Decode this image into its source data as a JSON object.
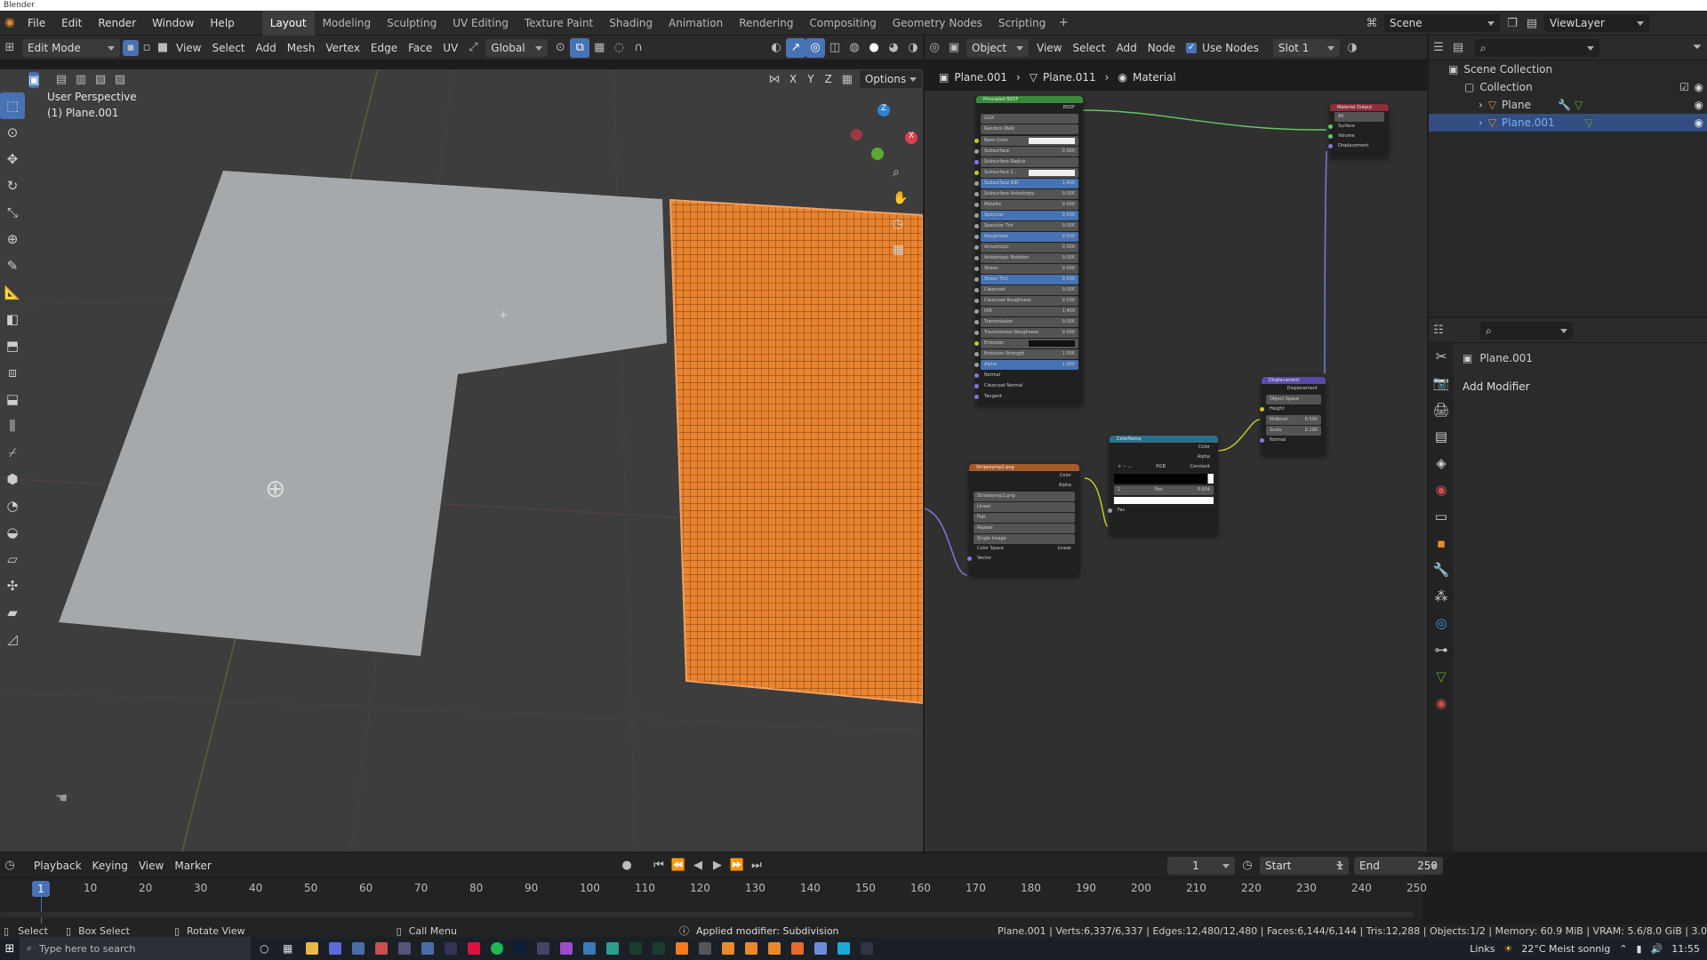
{
  "app": {
    "title": "Blender"
  },
  "menu": [
    "File",
    "Edit",
    "Render",
    "Window",
    "Help"
  ],
  "workspaces": [
    "Layout",
    "Modeling",
    "Sculpting",
    "UV Editing",
    "Texture Paint",
    "Shading",
    "Animation",
    "Rendering",
    "Compositing",
    "Geometry Nodes",
    "Scripting"
  ],
  "active_workspace": "Layout",
  "scene": "Scene",
  "view_layer": "ViewLayer",
  "viewport": {
    "mode": "Edit Mode",
    "menus": [
      "View",
      "Select",
      "Add",
      "Mesh",
      "Vertex",
      "Edge",
      "Face",
      "UV"
    ],
    "transform": "Global",
    "options": "Options",
    "axes": [
      "X",
      "Y",
      "Z"
    ],
    "overlay_line1": "User Perspective",
    "overlay_line2": "(1) Plane.001"
  },
  "node_editor": {
    "object_mode": "Object",
    "menus": [
      "View",
      "Select",
      "Add",
      "Node"
    ],
    "use_nodes": "Use Nodes",
    "slot": "Slot 1",
    "breadcrumb": [
      "Plane.001",
      "Plane.011",
      "Material"
    ],
    "nodes": {
      "principled": {
        "title": "Principled BSDF",
        "output": "BSDF",
        "dist": "GGX",
        "sss": "Random Walk",
        "rows": [
          [
            "Base Color",
            ""
          ],
          [
            "Subsurface",
            "0.000"
          ],
          [
            "Subsurface Radius",
            ""
          ],
          [
            "Subsurface C...",
            ""
          ],
          [
            "Subsurface IOR",
            "1.400"
          ],
          [
            "Subsurface Anisotropy",
            "0.000"
          ],
          [
            "Metallic",
            "0.000"
          ],
          [
            "Specular",
            "0.500"
          ],
          [
            "Specular Tint",
            "0.000"
          ],
          [
            "Roughness",
            "0.500"
          ],
          [
            "Anisotropic",
            "0.000"
          ],
          [
            "Anisotropic Rotation",
            "0.000"
          ],
          [
            "Sheen",
            "0.000"
          ],
          [
            "Sheen Tint",
            "0.500"
          ],
          [
            "Clearcoat",
            "0.000"
          ],
          [
            "Clearcoat Roughness",
            "0.030"
          ],
          [
            "IOR",
            "1.450"
          ],
          [
            "Transmission",
            "0.000"
          ],
          [
            "Transmission Roughness",
            "0.000"
          ],
          [
            "Emission",
            ""
          ],
          [
            "Emission Strength",
            "1.000"
          ],
          [
            "Alpha",
            "1.000"
          ],
          [
            "Normal",
            ""
          ],
          [
            "Clearcoat Normal",
            ""
          ],
          [
            "Tangent",
            ""
          ]
        ]
      },
      "output": {
        "title": "Material Output",
        "target": "All",
        "rows": [
          "Surface",
          "Volume",
          "Displacement"
        ]
      },
      "image": {
        "title": "Stripesymp2.png",
        "outputs": [
          "Color",
          "Alpha"
        ],
        "file": "Stripesymp2.png",
        "interp": "Linear",
        "proj": "Flat",
        "ext": "Repeat",
        "src": "Single Image",
        "cs_label": "Color Space",
        "cs": "Linear",
        "vector": "Vector"
      },
      "ramp": {
        "title": "ColorRamp",
        "outputs": [
          "Color",
          "Alpha"
        ],
        "mode": "RGB",
        "interp": "Constant",
        "idx": "1",
        "pos_label": "Pos",
        "pos": "0.934",
        "fac": "Fac"
      },
      "disp": {
        "title": "Displacement",
        "output": "Displacement",
        "space": "Object Space",
        "height": "Height",
        "midlevel_label": "Midlevel",
        "midlevel": "0.500",
        "scale_label": "Scale",
        "scale": "0.100",
        "normal": "Normal"
      }
    }
  },
  "outliner": {
    "root": "Scene Collection",
    "collection": "Collection",
    "items": [
      "Plane",
      "Plane.001"
    ]
  },
  "properties": {
    "object": "Plane.001",
    "add_modifier": "Add Modifier"
  },
  "timeline": {
    "menus": [
      "Playback",
      "Keying",
      "View",
      "Marker"
    ],
    "frame": "1",
    "start_label": "Start",
    "start": "1",
    "end_label": "End",
    "end": "250",
    "ticks": [
      "10",
      "20",
      "30",
      "40",
      "50",
      "60",
      "70",
      "80",
      "90",
      "100",
      "110",
      "120",
      "130",
      "140",
      "150",
      "160",
      "170",
      "180",
      "190",
      "200",
      "210",
      "220",
      "230",
      "240",
      "250"
    ],
    "current": "1"
  },
  "status": {
    "select": "Select",
    "box": "Box Select",
    "rotate": "Rotate View",
    "call": "Call Menu",
    "msg": "Applied modifier: Subdivision",
    "stats": "Plane.001 | Verts:6,337/6,337 | Edges:12,480/12,480 | Faces:6,144/6,144 | Tris:12,288 | Objects:1/2 | Memory: 60.9 MiB | VRAM: 5.6/8.0 GiB | 3.0"
  },
  "taskbar": {
    "search": "Type here to search",
    "links": "Links",
    "weather": "22°C  Meist sonnig",
    "time": "11:55"
  },
  "colors": {
    "accent": "#4772b3",
    "mesh": "#e07a2c",
    "plane": "#a5a9ab",
    "header": "#2b2b2b"
  }
}
